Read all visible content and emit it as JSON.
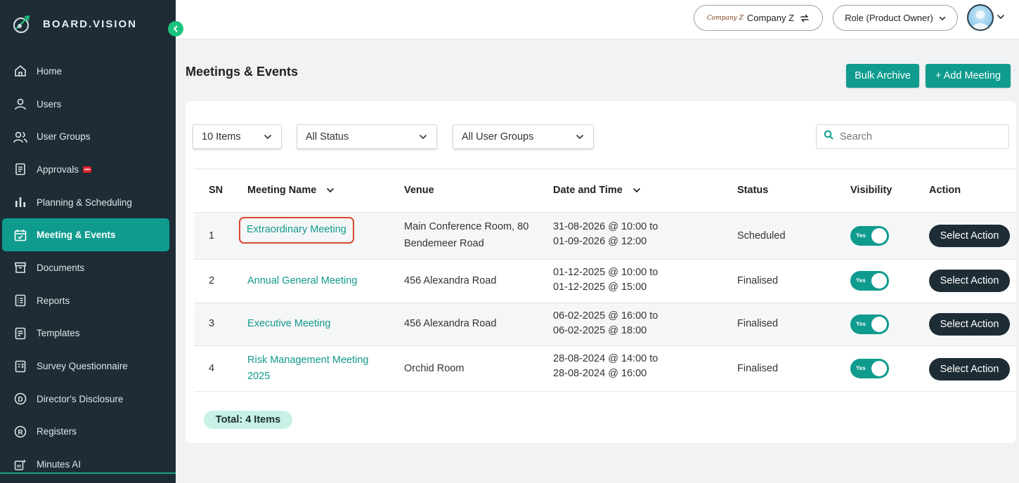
{
  "brand": {
    "name": "BOARD.VISION"
  },
  "sidebar": {
    "items": [
      {
        "label": "Home",
        "icon": "home-icon"
      },
      {
        "label": "Users",
        "icon": "user-icon"
      },
      {
        "label": "User Groups",
        "icon": "users-icon"
      },
      {
        "label": "Approvals",
        "icon": "approvals-icon",
        "badge": "•••"
      },
      {
        "label": "Planning & Scheduling",
        "icon": "bar-chart-icon"
      },
      {
        "label": "Meeting & Events",
        "icon": "calendar-check-icon",
        "active": true
      },
      {
        "label": "Documents",
        "icon": "archive-box-icon"
      },
      {
        "label": "Reports",
        "icon": "list-document-icon"
      },
      {
        "label": "Templates",
        "icon": "template-icon"
      },
      {
        "label": "Survey Questionnaire",
        "icon": "survey-icon"
      },
      {
        "label": "Director's Disclosure",
        "icon": "circle-d-icon"
      },
      {
        "label": "Registers",
        "icon": "circle-r-icon"
      },
      {
        "label": "Minutes AI",
        "icon": "minutes-ai-icon"
      }
    ]
  },
  "topbar": {
    "company_logo_text": "Company Z",
    "company_label": "Company Z",
    "role_label": "Role (Product Owner)"
  },
  "page": {
    "title": "Meetings & Events",
    "bulk_archive_label": "Bulk Archive",
    "add_meeting_label": "+ Add Meeting"
  },
  "filters": {
    "items_per_page": "10 Items",
    "status": "All Status",
    "user_groups": "All User Groups",
    "search_placeholder": "Search"
  },
  "table": {
    "columns": [
      "SN",
      "Meeting Name",
      "Venue",
      "Date and Time",
      "Status",
      "Visibility",
      "Action"
    ],
    "rows": [
      {
        "sn": "1",
        "name": "Extraordinary Meeting",
        "venue_l1": "Main Conference Room, 80",
        "venue_l2": "Bendemeer Road",
        "date_l1": "31-08-2026 @ 10:00 to",
        "date_l2": "01-09-2026 @ 12:00",
        "status": "Scheduled",
        "visibility": "Yes",
        "action": "Select Action"
      },
      {
        "sn": "2",
        "name": "Annual General Meeting",
        "venue_l1": "456 Alexandra Road",
        "venue_l2": "",
        "date_l1": "01-12-2025 @ 10:00 to",
        "date_l2": "01-12-2025 @ 15:00",
        "status": "Finalised",
        "visibility": "Yes",
        "action": "Select Action"
      },
      {
        "sn": "3",
        "name": "Executive Meeting",
        "venue_l1": "456 Alexandra Road",
        "venue_l2": "",
        "date_l1": "06-02-2025 @ 16:00 to",
        "date_l2": "06-02-2025 @ 18:00",
        "status": "Finalised",
        "visibility": "Yes",
        "action": "Select Action"
      },
      {
        "sn": "4",
        "name_l1": "Risk Management Meeting",
        "name_l2": "2025",
        "venue_l1": "Orchid Room",
        "venue_l2": "",
        "date_l1": "28-08-2024 @ 14:00 to",
        "date_l2": "28-08-2024 @ 16:00",
        "status": "Finalised",
        "visibility": "Yes",
        "action": "Select Action"
      }
    ],
    "total_label": "Total: 4 Items"
  },
  "colors": {
    "sidebar_bg": "#1e2c35",
    "accent": "#0f9b8e",
    "link": "#11998d",
    "highlight_border": "#d9482e",
    "action_btn": "#1e2c35",
    "total_pill_bg": "#c7f1e6"
  }
}
